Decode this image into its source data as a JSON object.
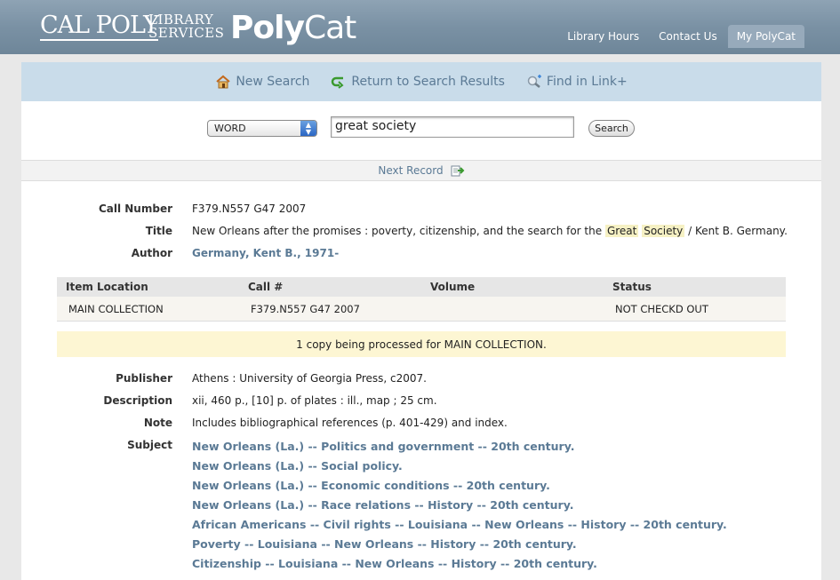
{
  "header": {
    "logo_calpoly": "CAL POLY",
    "logo_library_line1": "LIBRARY",
    "logo_library_line2": "SERVICES",
    "logo_poly": "Poly",
    "logo_cat": "Cat",
    "nav": [
      "Library Hours",
      "Contact Us",
      "My PolyCat"
    ]
  },
  "actions": {
    "new_search": "New Search",
    "return_results": "Return to Search Results",
    "find_linkplus": "Find in Link+"
  },
  "search": {
    "type_value": "WORD",
    "query": "great society",
    "button": "Search"
  },
  "next_record": "Next Record",
  "record": {
    "call_number_label": "Call Number",
    "call_number": "F379.N557 G47 2007",
    "title_label": "Title",
    "title_before": "New Orleans after the promises : poverty, citizenship, and the search for the",
    "title_hl1": "Great",
    "title_hl2": "Society",
    "title_after": "/ Kent B. Germany.",
    "author_label": "Author",
    "author": "Germany, Kent B., 1971-",
    "publisher_label": "Publisher",
    "publisher": "Athens : University of Georgia Press, c2007.",
    "description_label": "Description",
    "description": "xii, 460 p., [10] p. of plates : ill., map ; 25 cm.",
    "note_label": "Note",
    "note": "Includes bibliographical references (p. 401-429) and index.",
    "subject_label": "Subject",
    "subjects": [
      "New Orleans (La.) -- Politics and government -- 20th century.",
      "New Orleans (La.) -- Social policy.",
      "New Orleans (La.) -- Economic conditions -- 20th century.",
      "New Orleans (La.) -- Race relations -- History -- 20th century.",
      "African Americans -- Civil rights -- Louisiana -- New Orleans -- History -- 20th century.",
      "Poverty -- Louisiana -- New Orleans -- History -- 20th century.",
      "Citizenship -- Louisiana -- New Orleans -- History -- 20th century."
    ]
  },
  "holdings": {
    "headers": [
      "Item Location",
      "Call #",
      "Volume",
      "Status"
    ],
    "row": [
      "MAIN COLLECTION",
      "F379.N557 G47 2007",
      "",
      "NOT CHECKD OUT"
    ],
    "notice": "1 copy being processed for MAIN COLLECTION."
  }
}
